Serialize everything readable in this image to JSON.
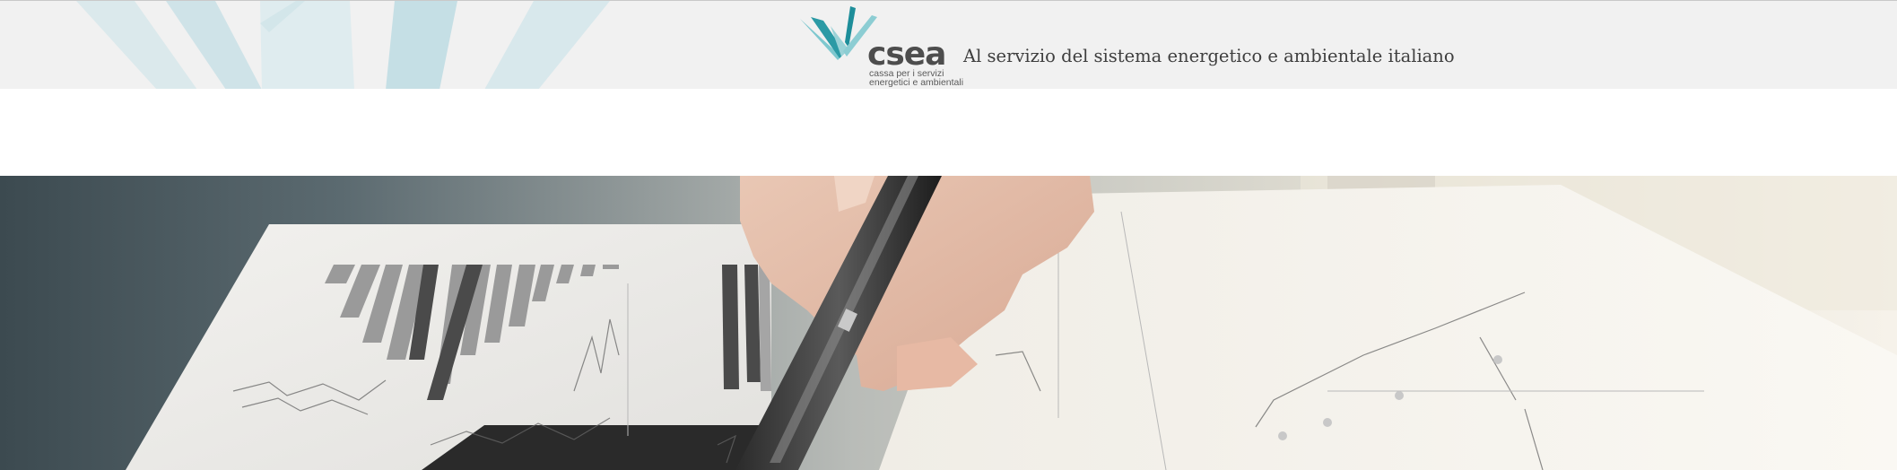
{
  "header": {
    "logo": {
      "wordmark": "csea",
      "subtitle_line1": "cassa per i servizi",
      "subtitle_line2": "energetici e ambientali",
      "colors": {
        "teal_dark": "#1e8e9a",
        "teal_light": "#7ec8cf",
        "word": "#4d4d4d"
      }
    },
    "tagline": "Al servizio del sistema energetico e ambientale italiano",
    "background": "#f1f1f1"
  },
  "hero": {
    "image": "business-analysis-photo",
    "description_icon": "hand-with-pen-over-charts-image"
  }
}
